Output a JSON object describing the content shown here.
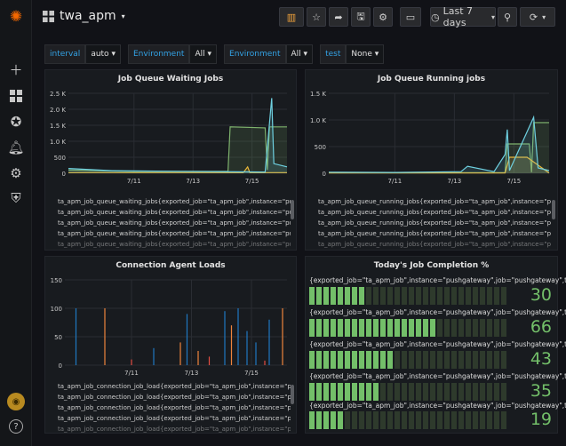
{
  "dashboard": {
    "title": "twa_apm"
  },
  "toolbar": {
    "time_range": "Last 7 days"
  },
  "variables": [
    {
      "label": "interval",
      "value": "auto"
    },
    {
      "label": "Environment",
      "value": "All"
    },
    {
      "label": "Environment",
      "value": "All"
    },
    {
      "label": "test",
      "value": "None"
    }
  ],
  "colors": {
    "green": "#7eb26d",
    "yellow": "#eab839",
    "cyan": "#6ed0e0",
    "orange": "#ef843c",
    "blue": "#1f78c1",
    "red": "#e24d42",
    "gauge_on": "#73bf69",
    "gauge_off": "#2e3a2c"
  },
  "panels": {
    "waiting": {
      "title": "Job Queue Waiting Jobs",
      "legend": [
        "ta_apm_job_queue_waiting_jobs{exported_job=\"ta_apm_job\",instance=\"pushgat",
        "ta_apm_job_queue_waiting_jobs{exported_job=\"ta_apm_job\",instance=\"pushgat",
        "ta_apm_job_queue_waiting_jobs{exported_job=\"ta_apm_job\",instance=\"pushgat",
        "ta_apm_job_queue_waiting_jobs{exported_job=\"ta_apm_job\",instance=\"pushgat",
        "ta_apm_job_queue_waiting_jobs{exported_job=\"ta_apm_job\",instance=\"pushgat"
      ]
    },
    "running": {
      "title": "Job Queue Running jobs",
      "legend": [
        "ta_apm_job_queue_running_jobs{exported_job=\"ta_apm_job\",instance=\"pushga",
        "ta_apm_job_queue_running_jobs{exported_job=\"ta_apm_job\",instance=\"pushga",
        "ta_apm_job_queue_running_jobs{exported_job=\"ta_apm_job\",instance=\"pushga",
        "ta_apm_job_queue_running_jobs{exported_job=\"ta_apm_job\",instance=\"pushga",
        "ta_apm_job_queue_running_jobs{exported_job=\"ta_apm_job\",instance=\"pushga"
      ]
    },
    "agent": {
      "title": "Connection Agent Loads",
      "legend": [
        "ta_apm_job_connection_job_load{exported_job=\"ta_apm_job\",instance=\"pushga",
        "ta_apm_job_connection_job_load{exported_job=\"ta_apm_job\",instance=\"pushga",
        "ta_apm_job_connection_job_load{exported_job=\"ta_apm_job\",instance=\"pushga",
        "ta_apm_job_connection_job_load{exported_job=\"ta_apm_job\",instance=\"pushga",
        "ta_apm_job_connection_job_load{exported_job=\"ta_apm_job\",instance=\"pushga"
      ]
    },
    "completion": {
      "title": "Today's Job Completion %",
      "rows": [
        {
          "label": "{exported_job=\"ta_apm_job\",instance=\"pushgateway\",job=\"pushgateway\",ta_en",
          "value": "30",
          "fraction": 0.3
        },
        {
          "label": "{exported_job=\"ta_apm_job\",instance=\"pushgateway\",job=\"pushgateway\",ta_en",
          "value": "66",
          "fraction": 0.66
        },
        {
          "label": "{exported_job=\"ta_apm_job\",instance=\"pushgateway\",job=\"pushgateway\",ta_en",
          "value": "43",
          "fraction": 0.43
        },
        {
          "label": "{exported_job=\"ta_apm_job\",instance=\"pushgateway\",job=\"pushgateway\",ta_en",
          "value": "35",
          "fraction": 0.35
        },
        {
          "label": "{exported_job=\"ta_apm_job\",instance=\"pushgateway\",job=\"pushgateway\",ta_en",
          "value": "19",
          "fraction": 0.19
        }
      ]
    }
  },
  "chart_data": [
    {
      "type": "line",
      "title": "Job Queue Waiting Jobs",
      "x_ticks": [
        "7/11",
        "7/13",
        "7/15"
      ],
      "y_ticks": [
        "0",
        "500",
        "1.0 K",
        "1.5 K",
        "2.0 K",
        "2.5 K"
      ],
      "ylim": [
        0,
        2500
      ],
      "series": [
        {
          "color": "green",
          "points": [
            [
              0,
              100
            ],
            [
              0.3,
              60
            ],
            [
              0.55,
              60
            ],
            [
              0.73,
              60
            ],
            [
              0.74,
              1450
            ],
            [
              0.9,
              1420
            ],
            [
              0.91,
              100
            ],
            [
              0.92,
              1450
            ],
            [
              1,
              1450
            ]
          ]
        },
        {
          "color": "yellow",
          "points": [
            [
              0,
              20
            ],
            [
              0.8,
              20
            ],
            [
              0.82,
              200
            ],
            [
              0.83,
              20
            ],
            [
              1,
              20
            ]
          ]
        },
        {
          "color": "cyan",
          "points": [
            [
              0,
              150
            ],
            [
              0.2,
              80
            ],
            [
              0.5,
              60
            ],
            [
              0.9,
              40
            ],
            [
              0.93,
              2350
            ],
            [
              0.94,
              300
            ],
            [
              1,
              200
            ]
          ]
        }
      ]
    },
    {
      "type": "line",
      "title": "Job Queue Running jobs",
      "x_ticks": [
        "7/11",
        "7/13",
        "7/15"
      ],
      "y_ticks": [
        "0",
        "500",
        "1.0 K",
        "1.5 K"
      ],
      "ylim": [
        0,
        1500
      ],
      "series": [
        {
          "color": "green",
          "points": [
            [
              0,
              10
            ],
            [
              0.6,
              10
            ],
            [
              0.8,
              10
            ],
            [
              0.81,
              550
            ],
            [
              0.91,
              550
            ],
            [
              0.92,
              20
            ],
            [
              0.93,
              950
            ],
            [
              1,
              950
            ]
          ]
        },
        {
          "color": "yellow",
          "points": [
            [
              0,
              5
            ],
            [
              0.8,
              5
            ],
            [
              0.82,
              300
            ],
            [
              0.9,
              300
            ],
            [
              1,
              5
            ]
          ]
        },
        {
          "color": "cyan",
          "points": [
            [
              0,
              20
            ],
            [
              0.3,
              15
            ],
            [
              0.6,
              30
            ],
            [
              0.63,
              130
            ],
            [
              0.75,
              30
            ],
            [
              0.8,
              350
            ],
            [
              0.81,
              820
            ],
            [
              0.82,
              50
            ],
            [
              0.93,
              1050
            ],
            [
              0.95,
              100
            ],
            [
              1,
              50
            ]
          ]
        }
      ]
    },
    {
      "type": "line",
      "title": "Connection Agent Loads",
      "x_ticks": [
        "7/11",
        "7/13",
        "7/15"
      ],
      "y_ticks": [
        "0",
        "50",
        "100",
        "150"
      ],
      "ylim": [
        0,
        150
      ],
      "series": [
        {
          "color": "blue",
          "spikes": [
            [
              0.05,
              100
            ],
            [
              0.4,
              30
            ],
            [
              0.55,
              90
            ],
            [
              0.72,
              95
            ],
            [
              0.78,
              100
            ],
            [
              0.82,
              60
            ],
            [
              0.86,
              40
            ],
            [
              0.92,
              80
            ]
          ]
        },
        {
          "color": "orange",
          "spikes": [
            [
              0.18,
              100
            ],
            [
              0.52,
              40
            ],
            [
              0.6,
              25
            ],
            [
              0.75,
              70
            ],
            [
              0.98,
              100
            ]
          ]
        },
        {
          "color": "red",
          "spikes": [
            [
              0.3,
              10
            ],
            [
              0.65,
              15
            ],
            [
              0.9,
              8
            ]
          ]
        }
      ]
    }
  ]
}
